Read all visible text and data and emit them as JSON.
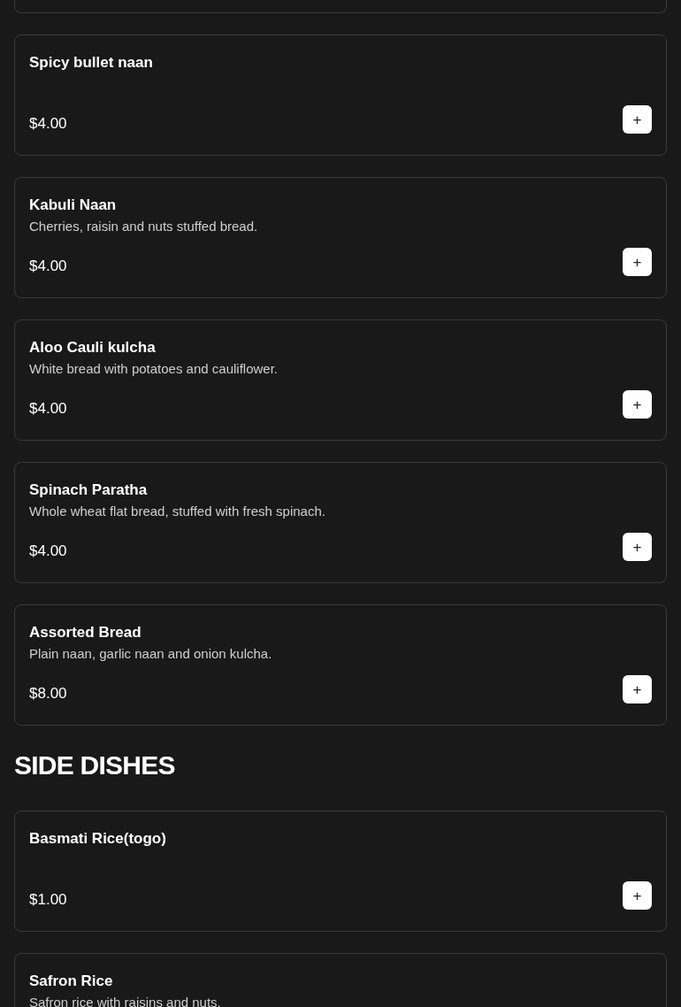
{
  "sections": [
    {
      "items": [
        {
          "name": "Spicy bullet naan",
          "price": "$4.00",
          "add_icon": "+"
        },
        {
          "name": "Kabuli Naan",
          "description": "Cherries, raisin and nuts stuffed bread.",
          "price": "$4.00",
          "add_icon": "+"
        },
        {
          "name": "Aloo Cauli kulcha",
          "description": "White bread with potatoes and cauliflower.",
          "price": "$4.00",
          "add_icon": "+"
        },
        {
          "name": "Spinach Paratha",
          "description": "Whole wheat flat bread, stuffed with fresh spinach.",
          "price": "$4.00",
          "add_icon": "+"
        },
        {
          "name": "Assorted Bread",
          "description": "Plain naan, garlic naan and onion kulcha.",
          "price": "$8.00",
          "add_icon": "+"
        }
      ]
    },
    {
      "title": "SIDE DISHES",
      "items": [
        {
          "name": "Basmati Rice(togo)",
          "price": "$1.00",
          "add_icon": "+"
        },
        {
          "name": "Safron Rice",
          "description": "Safron rice with raisins and nuts."
        }
      ]
    }
  ]
}
